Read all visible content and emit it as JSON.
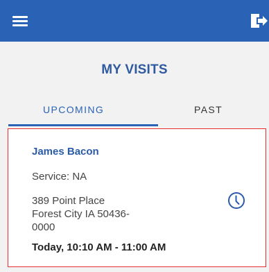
{
  "header": {
    "menu_icon": "hamburger-menu-icon",
    "logout_icon": "logout-icon",
    "background": "#2a63b6"
  },
  "page": {
    "title": "MY VISITS"
  },
  "tabs": [
    {
      "label": "UPCOMING",
      "active": true
    },
    {
      "label": "PAST",
      "active": false
    }
  ],
  "visits": [
    {
      "name": "James Bacon",
      "service": "Service: NA",
      "address_lines": [
        "389 Point Place",
        "Forest City IA 50436-",
        "0000"
      ],
      "time": "Today, 10:10 AM - 11:00 AM",
      "icon": "clock-icon",
      "highlight_color": "#e52d2d"
    }
  ]
}
